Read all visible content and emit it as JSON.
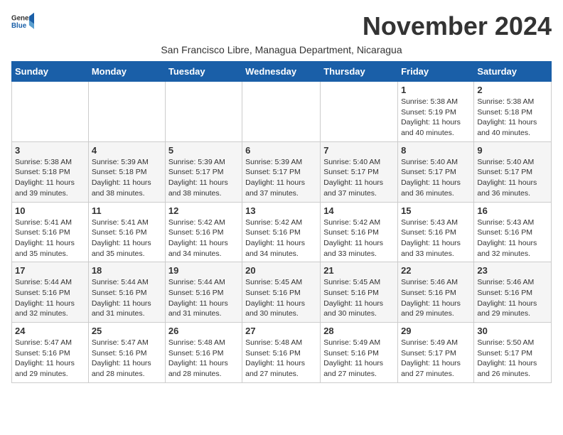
{
  "logo": {
    "line1": "General",
    "line2": "Blue"
  },
  "title": "November 2024",
  "subtitle": "San Francisco Libre, Managua Department, Nicaragua",
  "weekdays": [
    "Sunday",
    "Monday",
    "Tuesday",
    "Wednesday",
    "Thursday",
    "Friday",
    "Saturday"
  ],
  "weeks": [
    [
      {
        "day": "",
        "info": ""
      },
      {
        "day": "",
        "info": ""
      },
      {
        "day": "",
        "info": ""
      },
      {
        "day": "",
        "info": ""
      },
      {
        "day": "",
        "info": ""
      },
      {
        "day": "1",
        "info": "Sunrise: 5:38 AM\nSunset: 5:19 PM\nDaylight: 11 hours and 40 minutes."
      },
      {
        "day": "2",
        "info": "Sunrise: 5:38 AM\nSunset: 5:18 PM\nDaylight: 11 hours and 40 minutes."
      }
    ],
    [
      {
        "day": "3",
        "info": "Sunrise: 5:38 AM\nSunset: 5:18 PM\nDaylight: 11 hours and 39 minutes."
      },
      {
        "day": "4",
        "info": "Sunrise: 5:39 AM\nSunset: 5:18 PM\nDaylight: 11 hours and 38 minutes."
      },
      {
        "day": "5",
        "info": "Sunrise: 5:39 AM\nSunset: 5:17 PM\nDaylight: 11 hours and 38 minutes."
      },
      {
        "day": "6",
        "info": "Sunrise: 5:39 AM\nSunset: 5:17 PM\nDaylight: 11 hours and 37 minutes."
      },
      {
        "day": "7",
        "info": "Sunrise: 5:40 AM\nSunset: 5:17 PM\nDaylight: 11 hours and 37 minutes."
      },
      {
        "day": "8",
        "info": "Sunrise: 5:40 AM\nSunset: 5:17 PM\nDaylight: 11 hours and 36 minutes."
      },
      {
        "day": "9",
        "info": "Sunrise: 5:40 AM\nSunset: 5:17 PM\nDaylight: 11 hours and 36 minutes."
      }
    ],
    [
      {
        "day": "10",
        "info": "Sunrise: 5:41 AM\nSunset: 5:16 PM\nDaylight: 11 hours and 35 minutes."
      },
      {
        "day": "11",
        "info": "Sunrise: 5:41 AM\nSunset: 5:16 PM\nDaylight: 11 hours and 35 minutes."
      },
      {
        "day": "12",
        "info": "Sunrise: 5:42 AM\nSunset: 5:16 PM\nDaylight: 11 hours and 34 minutes."
      },
      {
        "day": "13",
        "info": "Sunrise: 5:42 AM\nSunset: 5:16 PM\nDaylight: 11 hours and 34 minutes."
      },
      {
        "day": "14",
        "info": "Sunrise: 5:42 AM\nSunset: 5:16 PM\nDaylight: 11 hours and 33 minutes."
      },
      {
        "day": "15",
        "info": "Sunrise: 5:43 AM\nSunset: 5:16 PM\nDaylight: 11 hours and 33 minutes."
      },
      {
        "day": "16",
        "info": "Sunrise: 5:43 AM\nSunset: 5:16 PM\nDaylight: 11 hours and 32 minutes."
      }
    ],
    [
      {
        "day": "17",
        "info": "Sunrise: 5:44 AM\nSunset: 5:16 PM\nDaylight: 11 hours and 32 minutes."
      },
      {
        "day": "18",
        "info": "Sunrise: 5:44 AM\nSunset: 5:16 PM\nDaylight: 11 hours and 31 minutes."
      },
      {
        "day": "19",
        "info": "Sunrise: 5:44 AM\nSunset: 5:16 PM\nDaylight: 11 hours and 31 minutes."
      },
      {
        "day": "20",
        "info": "Sunrise: 5:45 AM\nSunset: 5:16 PM\nDaylight: 11 hours and 30 minutes."
      },
      {
        "day": "21",
        "info": "Sunrise: 5:45 AM\nSunset: 5:16 PM\nDaylight: 11 hours and 30 minutes."
      },
      {
        "day": "22",
        "info": "Sunrise: 5:46 AM\nSunset: 5:16 PM\nDaylight: 11 hours and 29 minutes."
      },
      {
        "day": "23",
        "info": "Sunrise: 5:46 AM\nSunset: 5:16 PM\nDaylight: 11 hours and 29 minutes."
      }
    ],
    [
      {
        "day": "24",
        "info": "Sunrise: 5:47 AM\nSunset: 5:16 PM\nDaylight: 11 hours and 29 minutes."
      },
      {
        "day": "25",
        "info": "Sunrise: 5:47 AM\nSunset: 5:16 PM\nDaylight: 11 hours and 28 minutes."
      },
      {
        "day": "26",
        "info": "Sunrise: 5:48 AM\nSunset: 5:16 PM\nDaylight: 11 hours and 28 minutes."
      },
      {
        "day": "27",
        "info": "Sunrise: 5:48 AM\nSunset: 5:16 PM\nDaylight: 11 hours and 27 minutes."
      },
      {
        "day": "28",
        "info": "Sunrise: 5:49 AM\nSunset: 5:16 PM\nDaylight: 11 hours and 27 minutes."
      },
      {
        "day": "29",
        "info": "Sunrise: 5:49 AM\nSunset: 5:17 PM\nDaylight: 11 hours and 27 minutes."
      },
      {
        "day": "30",
        "info": "Sunrise: 5:50 AM\nSunset: 5:17 PM\nDaylight: 11 hours and 26 minutes."
      }
    ]
  ]
}
